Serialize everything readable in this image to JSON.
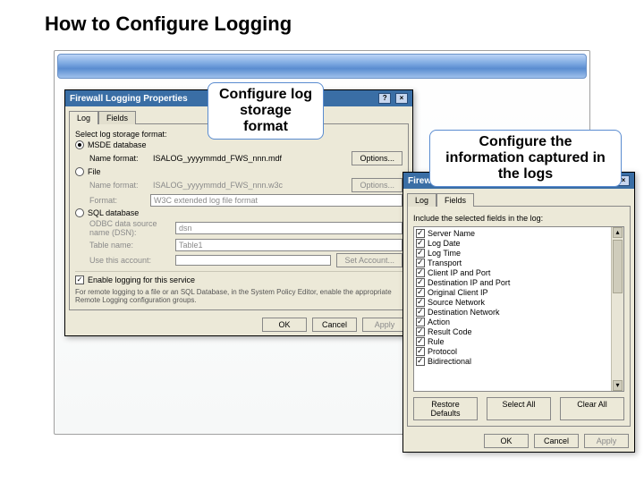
{
  "page_title": "How to Configure Logging",
  "annotations": {
    "a1": "Configure log storage format",
    "a2": "Configure the information captured in the logs"
  },
  "dialog1": {
    "title": "Firewall Logging Properties",
    "tabs": {
      "log": "Log",
      "fields": "Fields"
    },
    "storage_label": "Select log storage format:",
    "radios": {
      "msde": "MSDE database",
      "file": "File",
      "sql": "SQL database"
    },
    "name_label": "Name format:",
    "name_value_msde": "ISALOG_yyyymmdd_FWS_nnn.mdf",
    "options_btn": "Options...",
    "name_value_file": "ISALOG_yyyymmdd_FWS_nnn.w3c",
    "format_label": "Format:",
    "format_value": "W3C extended log file format",
    "dsn_label": "ODBC data source name (DSN):",
    "dsn_value": "dsn",
    "table_label": "Table name:",
    "table_value": "Table1",
    "account_label": "Use this account:",
    "set_account_btn": "Set Account...",
    "enable_label": "Enable logging for this service",
    "note": "For remote logging to a file or an SQL Database, in the System Policy Editor, enable the appropriate Remote Logging configuration groups.",
    "buttons": {
      "ok": "OK",
      "cancel": "Cancel",
      "apply": "Apply"
    }
  },
  "dialog2": {
    "title": "Firewall Logging Properties",
    "tabs": {
      "log": "Log",
      "fields": "Fields"
    },
    "note": "Include the selected fields in the log:",
    "fields": [
      "Server Name",
      "Log Date",
      "Log Time",
      "Transport",
      "Client IP and Port",
      "Destination IP and Port",
      "Original Client IP",
      "Source Network",
      "Destination Network",
      "Action",
      "Result Code",
      "Rule",
      "Protocol",
      "Bidirectional"
    ],
    "restore_btn": "Restore Defaults",
    "selectall_btn": "Select All",
    "clearall_btn": "Clear All",
    "buttons": {
      "ok": "OK",
      "cancel": "Cancel",
      "apply": "Apply"
    }
  }
}
